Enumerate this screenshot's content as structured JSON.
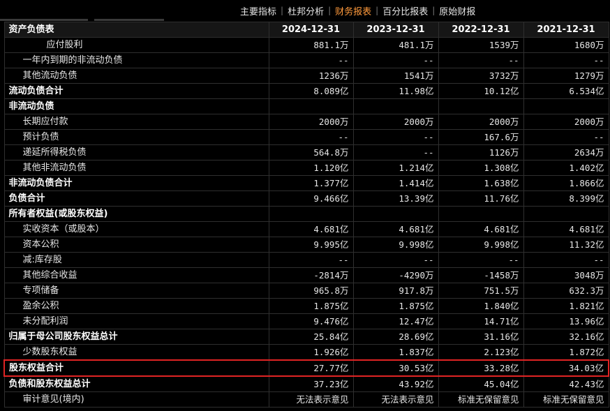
{
  "nav": {
    "tabs": [
      "主要指标",
      "杜邦分析",
      "财务报表",
      "百分比报表",
      "原始财报"
    ],
    "active_index": 2,
    "separator": "|"
  },
  "table": {
    "title": "资产负债表",
    "columns": [
      "2024-12-31",
      "2023-12-31",
      "2022-12-31",
      "2021-12-31"
    ],
    "rows": [
      {
        "label": "应付股利",
        "style": "indent2",
        "values": [
          "881.1万",
          "481.1万",
          "1539万",
          "1680万"
        ]
      },
      {
        "label": "一年内到期的非流动负债",
        "style": "indent",
        "values": [
          "--",
          "--",
          "--",
          "--"
        ]
      },
      {
        "label": "其他流动负债",
        "style": "indent",
        "values": [
          "1236万",
          "1541万",
          "3732万",
          "1279万"
        ]
      },
      {
        "label": "流动负债合计",
        "style": "total",
        "values": [
          "8.089亿",
          "11.98亿",
          "10.12亿",
          "6.534亿"
        ]
      },
      {
        "label": "非流动负债",
        "style": "section",
        "values": [
          "",
          "",
          "",
          ""
        ]
      },
      {
        "label": "长期应付款",
        "style": "indent",
        "values": [
          "2000万",
          "2000万",
          "2000万",
          "2000万"
        ]
      },
      {
        "label": "预计负债",
        "style": "indent",
        "values": [
          "--",
          "--",
          "167.6万",
          "--"
        ]
      },
      {
        "label": "递延所得税负债",
        "style": "indent",
        "values": [
          "564.8万",
          "--",
          "1126万",
          "2634万"
        ]
      },
      {
        "label": "其他非流动负债",
        "style": "indent",
        "values": [
          "1.120亿",
          "1.214亿",
          "1.308亿",
          "1.402亿"
        ]
      },
      {
        "label": "非流动负债合计",
        "style": "total",
        "values": [
          "1.377亿",
          "1.414亿",
          "1.638亿",
          "1.866亿"
        ]
      },
      {
        "label": "负债合计",
        "style": "total",
        "values": [
          "9.466亿",
          "13.39亿",
          "11.76亿",
          "8.399亿"
        ]
      },
      {
        "label": "所有者权益(或股东权益)",
        "style": "section",
        "values": [
          "",
          "",
          "",
          ""
        ]
      },
      {
        "label": "实收资本（或股本）",
        "style": "indent",
        "values": [
          "4.681亿",
          "4.681亿",
          "4.681亿",
          "4.681亿"
        ]
      },
      {
        "label": "资本公积",
        "style": "indent",
        "values": [
          "9.995亿",
          "9.998亿",
          "9.998亿",
          "11.32亿"
        ]
      },
      {
        "label": "减:库存股",
        "style": "indent",
        "values": [
          "--",
          "--",
          "--",
          "--"
        ]
      },
      {
        "label": "其他综合收益",
        "style": "indent",
        "values": [
          "-2814万",
          "-4290万",
          "-1458万",
          "3048万"
        ]
      },
      {
        "label": "专项储备",
        "style": "indent",
        "values": [
          "965.8万",
          "917.8万",
          "751.5万",
          "632.3万"
        ]
      },
      {
        "label": "盈余公积",
        "style": "indent",
        "values": [
          "1.875亿",
          "1.875亿",
          "1.840亿",
          "1.821亿"
        ]
      },
      {
        "label": "未分配利润",
        "style": "indent",
        "values": [
          "9.476亿",
          "12.47亿",
          "14.71亿",
          "13.96亿"
        ]
      },
      {
        "label": "归属于母公司股东权益总计",
        "style": "total",
        "values": [
          "25.84亿",
          "28.69亿",
          "31.16亿",
          "32.16亿"
        ]
      },
      {
        "label": "少数股东权益",
        "style": "indent",
        "values": [
          "1.926亿",
          "1.837亿",
          "2.123亿",
          "1.872亿"
        ]
      },
      {
        "label": "股东权益合计",
        "style": "total hl",
        "values": [
          "27.77亿",
          "30.53亿",
          "33.28亿",
          "34.03亿"
        ]
      },
      {
        "label": "负债和股东权益总计",
        "style": "total",
        "values": [
          "37.23亿",
          "43.92亿",
          "45.04亿",
          "42.43亿"
        ]
      },
      {
        "label": "审计意见(境内)",
        "style": "indent",
        "values": [
          "无法表示意见",
          "无法表示意见",
          "标准无保留意见",
          "标准无保留意见"
        ]
      }
    ]
  },
  "colors": {
    "active_tab": "#ff9a3c",
    "highlight_border": "#e02424",
    "background": "#000000"
  }
}
